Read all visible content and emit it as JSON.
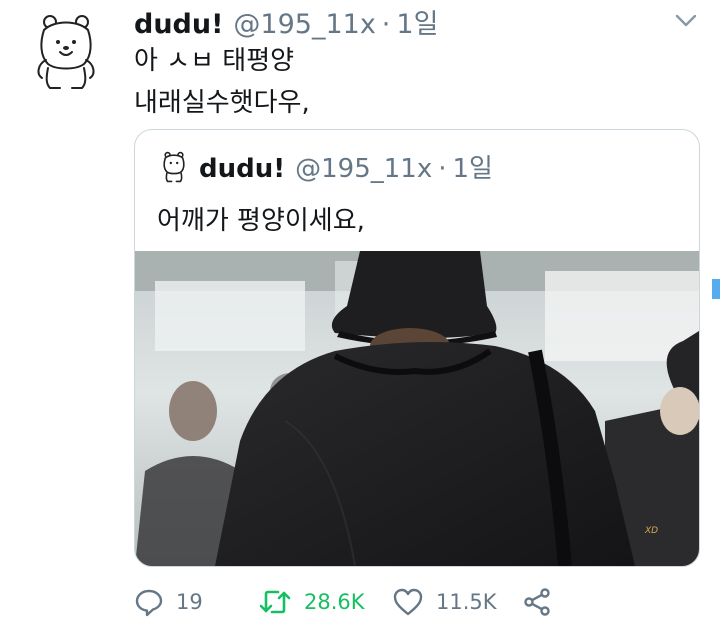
{
  "tweet": {
    "author_name": "dudu!",
    "handle": "@195_11x",
    "separator": "·",
    "time": "1일",
    "line1": "아 ㅅㅂ 태평양",
    "line2": "내래실수햇다우,"
  },
  "quoted": {
    "author_name": "dudu!",
    "handle": "@195_11x",
    "separator": "·",
    "time": "1일",
    "text": "어깨가 평양이세요,",
    "media_watermark": "XD"
  },
  "actions": {
    "reply_count": "19",
    "retweet_count": "28.6K",
    "like_count": "11.5K"
  },
  "icons": [
    "bear-avatar-icon",
    "chevron-down-icon",
    "reply-icon",
    "retweet-icon",
    "like-icon",
    "share-icon"
  ],
  "colors": {
    "retweet_active": "#17bf63",
    "muted": "#657786",
    "border": "#ccd6dd"
  }
}
